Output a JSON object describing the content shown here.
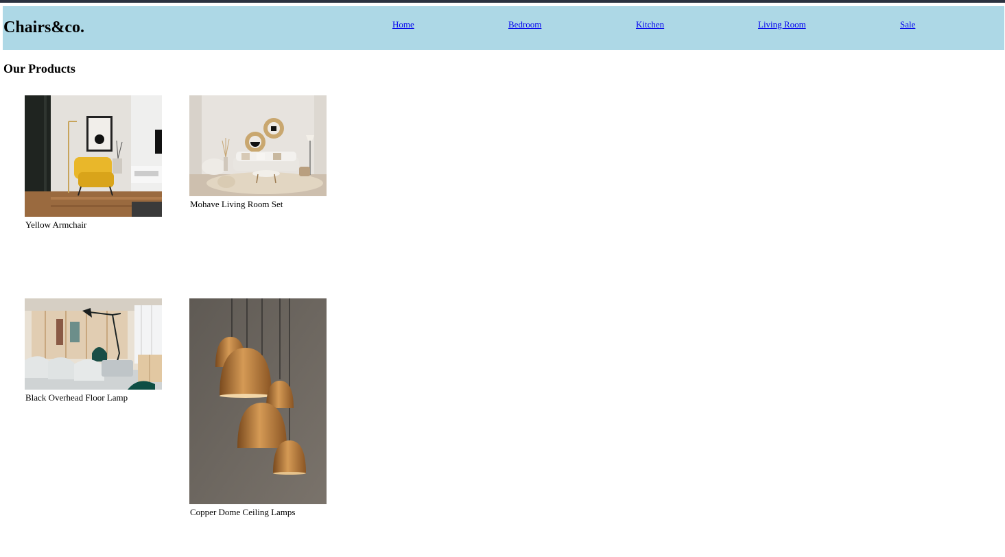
{
  "header": {
    "logo": "Chairs&co.",
    "nav": [
      "Home",
      "Bedroom",
      "Kitchen",
      "Living Room",
      "Sale"
    ]
  },
  "main": {
    "title": "Our Products",
    "products": [
      {
        "name": "Yellow Armchair"
      },
      {
        "name": "Mohave Living Room Set"
      },
      {
        "name": "Black Overhead Floor Lamp"
      },
      {
        "name": "Copper Dome Ceiling Lamps"
      }
    ]
  },
  "colors": {
    "header_bg": "#add8e6",
    "link": "#0000ee",
    "top_bar": "#2b3240"
  }
}
